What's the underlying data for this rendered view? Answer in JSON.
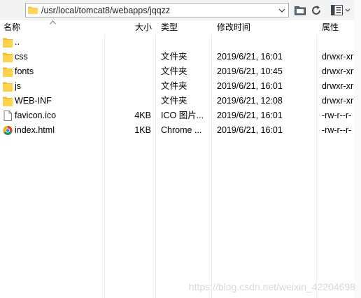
{
  "toolbar": {
    "path": "/usr/local/tomcat8/webapps/jqqzz"
  },
  "columns": {
    "name": "名称",
    "size": "大小",
    "type": "类型",
    "modified": "修改时间",
    "attributes": "属性"
  },
  "files": [
    {
      "name": "..",
      "size": "",
      "type": "",
      "modified": "",
      "attributes": "",
      "icon": "folder-icon"
    },
    {
      "name": "css",
      "size": "",
      "type": "文件夹",
      "modified": "2019/6/21, 16:01",
      "attributes": "drwxr-xr",
      "icon": "folder-icon"
    },
    {
      "name": "fonts",
      "size": "",
      "type": "文件夹",
      "modified": "2019/6/21, 10:45",
      "attributes": "drwxr-xr",
      "icon": "folder-icon"
    },
    {
      "name": "js",
      "size": "",
      "type": "文件夹",
      "modified": "2019/6/21, 16:01",
      "attributes": "drwxr-xr",
      "icon": "folder-icon"
    },
    {
      "name": "WEB-INF",
      "size": "",
      "type": "文件夹",
      "modified": "2019/6/21, 12:08",
      "attributes": "drwxr-xr",
      "icon": "folder-icon"
    },
    {
      "name": "favicon.ico",
      "size": "4KB",
      "type": "ICO 图片...",
      "modified": "2019/6/21, 16:01",
      "attributes": "-rw-r--r-",
      "icon": "file-icon"
    },
    {
      "name": "index.html",
      "size": "1KB",
      "type": "Chrome ...",
      "modified": "2019/6/21, 16:01",
      "attributes": "-rw-r--r-",
      "icon": "chrome-icon"
    }
  ],
  "watermark": "https://blog.csdn.net/weixin_42204698"
}
